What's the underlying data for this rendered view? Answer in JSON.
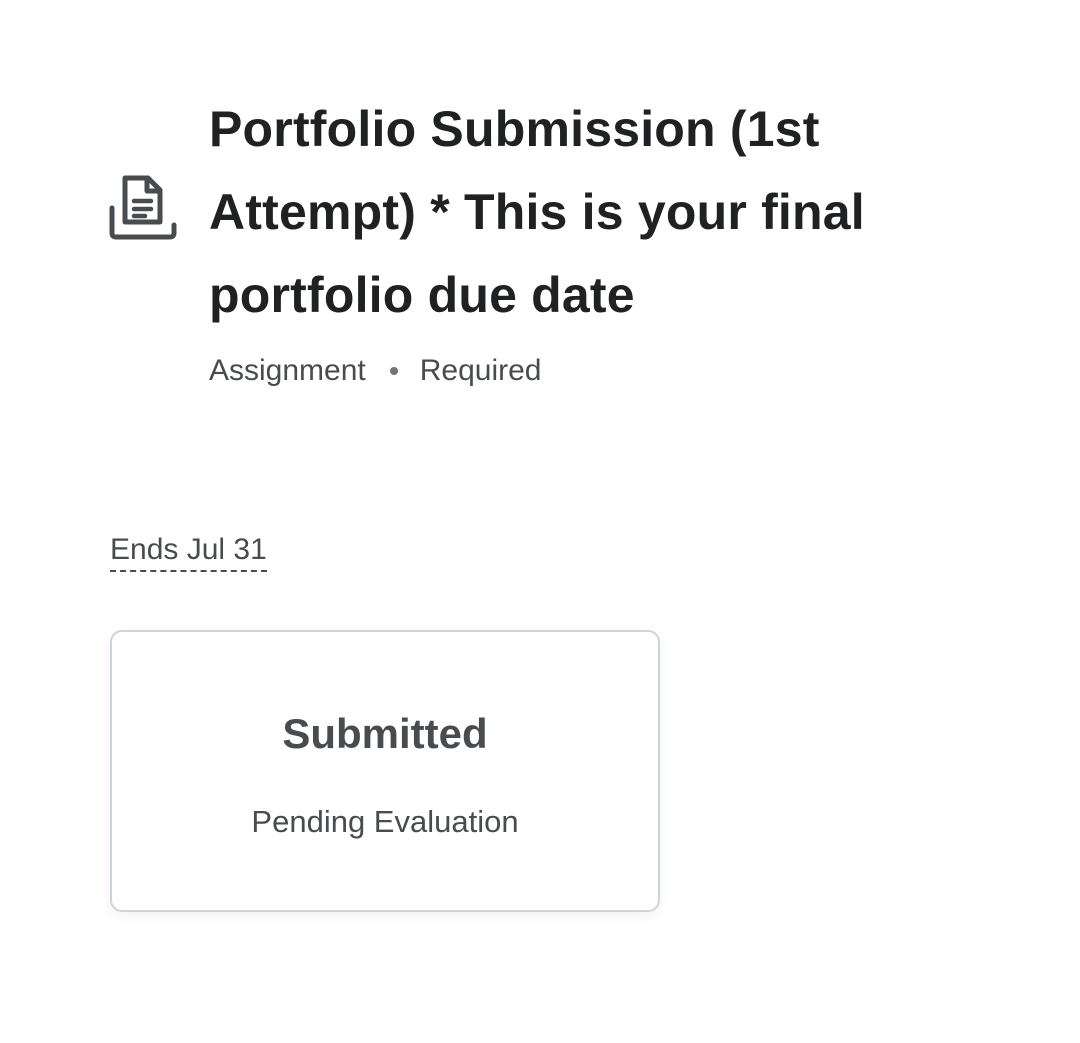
{
  "activity": {
    "icon": "assignment-document-icon",
    "title": "Portfolio Submission (1st Attempt) * This is your final portfolio due date",
    "type": "Assignment",
    "requirement": "Required",
    "ends": "Ends Jul 31"
  },
  "status": {
    "title": "Submitted",
    "subtitle": "Pending Evaluation"
  },
  "colors": {
    "text_primary": "#202122",
    "text_secondary": "#494c4e",
    "card_border": "#cdd5dc"
  }
}
